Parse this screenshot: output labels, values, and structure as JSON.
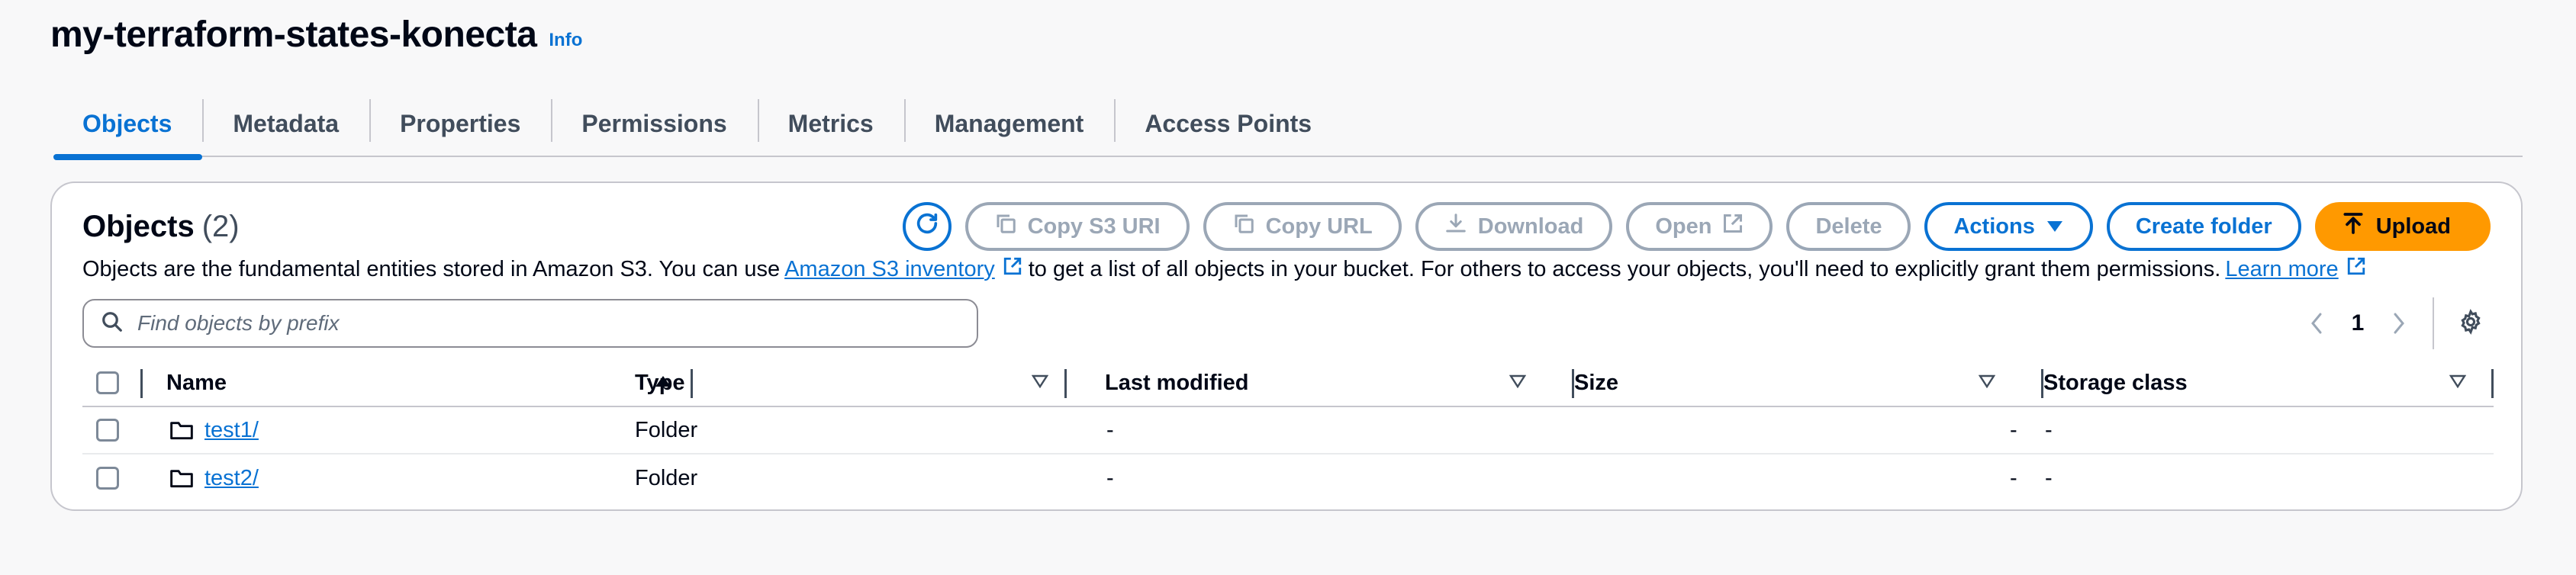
{
  "bucket": {
    "title": "my-terraform-states-konecta",
    "info_label": "Info"
  },
  "tabs": [
    {
      "label": "Objects",
      "active": true
    },
    {
      "label": "Metadata"
    },
    {
      "label": "Properties"
    },
    {
      "label": "Permissions"
    },
    {
      "label": "Metrics"
    },
    {
      "label": "Management"
    },
    {
      "label": "Access Points"
    }
  ],
  "objects_panel": {
    "title": "Objects",
    "count": "(2)",
    "toolbar": {
      "refresh_icon": "refresh-icon",
      "copy_s3_uri": "Copy S3 URI",
      "copy_url": "Copy URL",
      "download": "Download",
      "open": "Open",
      "delete": "Delete",
      "actions": "Actions",
      "create_folder": "Create folder",
      "upload": "Upload"
    },
    "description": {
      "before": "Objects are the fundamental entities stored in Amazon S3. You can use",
      "inventory_link": "Amazon S3 inventory",
      "middle": "to get a list of all objects in your bucket. For others to access your objects, you'll need to explicitly grant them permissions.",
      "learn_more": "Learn more"
    },
    "search": {
      "placeholder": "Find objects by prefix",
      "value": ""
    },
    "pagination": {
      "current_page": "1"
    },
    "table": {
      "columns": [
        "Name",
        "Type",
        "Last modified",
        "Size",
        "Storage class"
      ],
      "rows": [
        {
          "name": "test1/",
          "type": "Folder",
          "last_modified": "-",
          "size": "-",
          "storage_class": "-"
        },
        {
          "name": "test2/",
          "type": "Folder",
          "last_modified": "-",
          "size": "-",
          "storage_class": "-"
        }
      ]
    }
  },
  "colors": {
    "accent": "#0972d3",
    "primary_button": "#ff9900",
    "disabled": "#9ba7b6",
    "text": "#000716"
  }
}
